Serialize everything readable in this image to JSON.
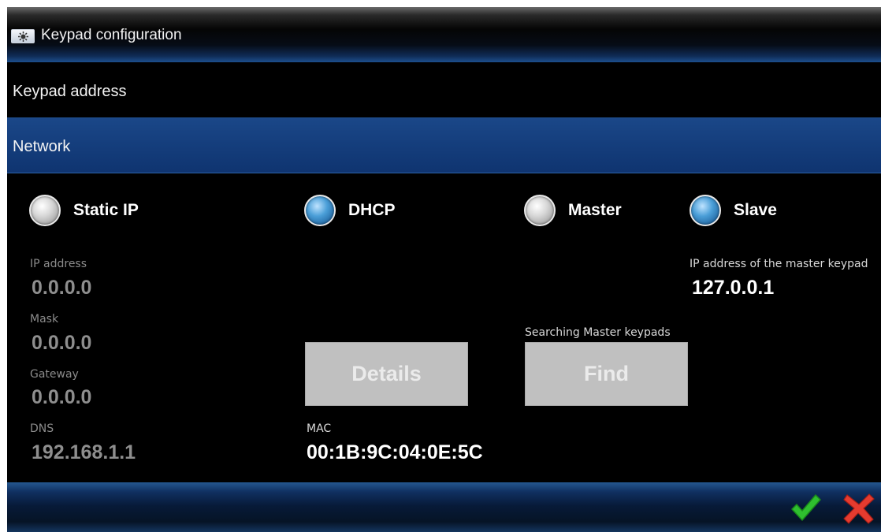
{
  "window": {
    "title": "Keypad configuration",
    "icon": "keypad-settings-icon"
  },
  "menu": {
    "keypad_address": "Keypad address",
    "network": "Network"
  },
  "ip_mode": {
    "static_ip": {
      "label": "Static IP",
      "checked": false
    },
    "dhcp": {
      "label": "DHCP",
      "checked": true
    }
  },
  "role": {
    "master": {
      "label": "Master",
      "checked": false
    },
    "slave": {
      "label": "Slave",
      "checked": true
    }
  },
  "fields": {
    "ip_address": {
      "label": "IP address",
      "value": "0.0.0.0"
    },
    "mask": {
      "label": "Mask",
      "value": "0.0.0.0"
    },
    "gateway": {
      "label": "Gateway",
      "value": "0.0.0.0"
    },
    "dns": {
      "label": "DNS",
      "value": "192.168.1.1"
    },
    "mac": {
      "label": "MAC",
      "value": "00:1B:9C:04:0E:5C"
    },
    "master_ip": {
      "label": "IP address of the master keypad",
      "value": "127.0.0.1"
    }
  },
  "search_status": "Searching Master keypads",
  "buttons": {
    "details": "Details",
    "find": "Find"
  },
  "actions": {
    "confirm_icon": "check-icon",
    "cancel_icon": "close-icon"
  },
  "colors": {
    "accent": "#1a4788",
    "confirm": "#2fbf2f",
    "cancel": "#e53b2f"
  }
}
